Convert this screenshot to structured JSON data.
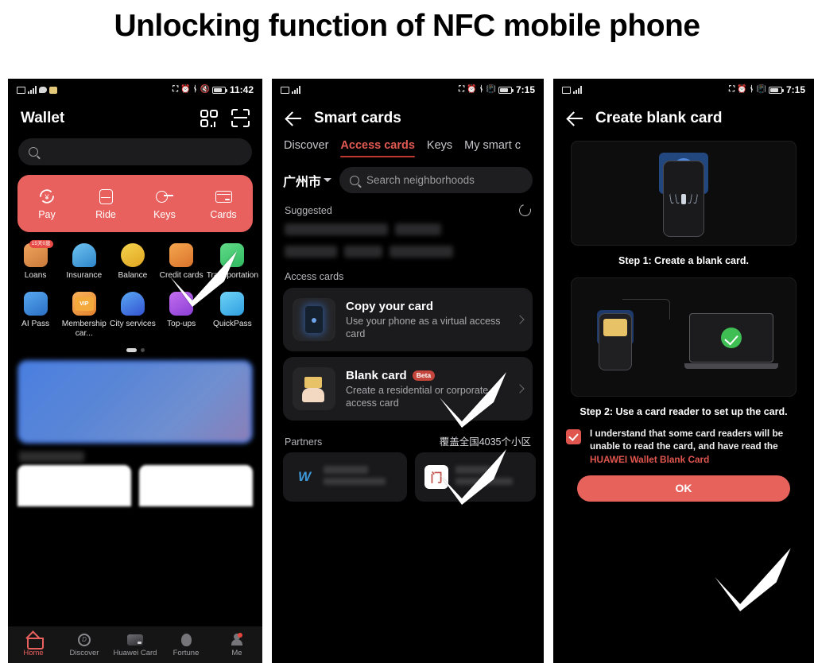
{
  "title": "Unlocking function of NFC mobile phone",
  "colors": {
    "accent_red": "#e8615e",
    "tab_active": "#e05a52",
    "beta_badge": "#c4453c",
    "green": "#3fbe54",
    "card_blue": "#4f87de"
  },
  "phone1": {
    "status": {
      "time": "11:42"
    },
    "header": {
      "title": "Wallet",
      "icon_scan": "scan-code-icon",
      "icon_frame": "scan-frame-icon"
    },
    "search": {
      "placeholder": ""
    },
    "quick_actions": [
      {
        "label": "Pay",
        "icon": "pay-icon"
      },
      {
        "label": "Ride",
        "icon": "bus-icon"
      },
      {
        "label": "Keys",
        "icon": "key-icon"
      },
      {
        "label": "Cards",
        "icon": "card-icon"
      }
    ],
    "grid": [
      {
        "label": "Loans",
        "badge": "15天0息"
      },
      {
        "label": "Insurance",
        "badge": ""
      },
      {
        "label": "Balance",
        "badge": ""
      },
      {
        "label": "Credit cards",
        "badge": ""
      },
      {
        "label": "Transportation",
        "badge": ""
      },
      {
        "label": "AI Pass",
        "badge": ""
      },
      {
        "label": "Membership car...",
        "badge": "VIP"
      },
      {
        "label": "City services",
        "badge": ""
      },
      {
        "label": "Top-ups",
        "badge": ""
      },
      {
        "label": "QuickPass",
        "badge": ""
      }
    ],
    "pager": {
      "current": 1,
      "total": 2
    },
    "tabbar": [
      {
        "label": "Home",
        "icon": "home-icon",
        "active": true,
        "badge": false
      },
      {
        "label": "Discover",
        "icon": "compass-icon",
        "active": false,
        "badge": false
      },
      {
        "label": "Huawei Card",
        "icon": "bank-card-icon",
        "active": false,
        "badge": false
      },
      {
        "label": "Fortune",
        "icon": "piggy-bank-icon",
        "active": false,
        "badge": false
      },
      {
        "label": "Me",
        "icon": "person-icon",
        "active": false,
        "badge": true
      }
    ]
  },
  "phone2": {
    "status": {
      "time": "7:15"
    },
    "header": {
      "title": "Smart cards",
      "back": "back-arrow-icon"
    },
    "tabs": [
      {
        "label": "Discover",
        "active": false
      },
      {
        "label": "Access cards",
        "active": true
      },
      {
        "label": "Keys",
        "active": false
      },
      {
        "label": "My smart c",
        "active": false
      }
    ],
    "city": "广州市",
    "search": {
      "placeholder": "Search neighborhoods"
    },
    "suggested": {
      "label": "Suggested",
      "refresh": "refresh-icon"
    },
    "access_cards": {
      "section_label": "Access cards",
      "items": [
        {
          "title": "Copy your card",
          "badge": "",
          "subtitle": "Use your phone as a virtual access card",
          "icon": "phone-nfc-icon"
        },
        {
          "title": "Blank card",
          "badge": "Beta",
          "subtitle": "Create a residential or corporate access card",
          "icon": "hand-card-icon"
        }
      ]
    },
    "partners": {
      "label": "Partners",
      "coverage": "覆盖全国4035个小区"
    }
  },
  "phone3": {
    "status": {
      "time": "7:15"
    },
    "header": {
      "title": "Create blank card",
      "back": "back-arrow-icon"
    },
    "steps": [
      {
        "text": "Step 1: Create a blank card.",
        "illustration": "phone-tap-reader-illustration"
      },
      {
        "text": "Step 2: Use a card reader to set up the card.",
        "illustration": "card-reader-laptop-illustration"
      }
    ],
    "agreement": {
      "checked": true,
      "text_before": "I understand that some card readers will be unable to read the card, and have read the ",
      "link": "HUAWEI Wallet Blank Card"
    },
    "ok_button": "OK"
  }
}
